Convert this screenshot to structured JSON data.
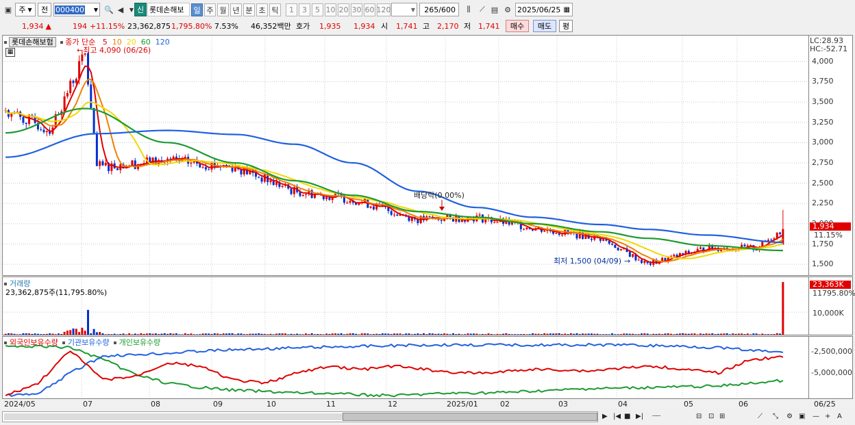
{
  "toolbar": {
    "period_select": "주",
    "prev_label": "전",
    "code_value": "000400",
    "sin_label": "신",
    "stock_name": "롯데손해보",
    "period_tabs": [
      "일",
      "주",
      "월",
      "년",
      "분",
      "초",
      "틱"
    ],
    "active_period": "일",
    "interval_buttons": [
      "1",
      "3",
      "5",
      "10",
      "20",
      "30",
      "60",
      "120"
    ],
    "count_value": "265",
    "count_max": "/600",
    "date_value": "2025/06/25"
  },
  "quote": {
    "price": "1,934",
    "change": "194",
    "change_pct": "+11.15%",
    "volume": "23,362,875",
    "volume_pct": "1,795.80%",
    "turnover": "7.53%",
    "amount": "46,352백만",
    "bid_label": "호가",
    "bid_ask": "1,935",
    "bid_bid": "1,934",
    "open_label": "시",
    "open": "1,741",
    "high_label": "고",
    "high": "2,170",
    "low_label": "저",
    "low": "1,741",
    "buy_label": "매수",
    "sell_label": "매도",
    "flat_label": "평"
  },
  "price_panel": {
    "name_tag": "롯데손해보험",
    "ma_title": "종가 단순",
    "ma_periods": [
      "5",
      "10",
      "20",
      "60",
      "120"
    ],
    "ma_colors": [
      "#e00000",
      "#f08000",
      "#f0d800",
      "#1a9a30",
      "#2060e0"
    ],
    "lc_label": "LC:28.93",
    "hc_label": "HC:-52.71",
    "high_annotation": "최고 4,090 (06/26)",
    "low_annotation": "최저 1,500 (04/09)",
    "dividend_annotation": "배당락(0.00%)",
    "last_price_tag": "1,934",
    "last_change_tag": "11.15%",
    "y_ticks": [
      "4,000",
      "3,750",
      "3,500",
      "3,250",
      "3,000",
      "2,750",
      "2,500",
      "2,250",
      "2,000",
      "1,750",
      "1,500"
    ]
  },
  "volume_panel": {
    "title": "거래량",
    "value_text": "23,362,875주(11,795.80%)",
    "last_tag": "23,363K",
    "last_pct_tag": "11795.80%",
    "y_tick": "10,000K"
  },
  "holdings_panel": {
    "series_labels": [
      "외국인보유수량",
      "기관보유수량",
      "개인보유수량"
    ],
    "series_colors": [
      "#e00000",
      "#2060e0",
      "#1a9a30"
    ],
    "y_ticks": [
      "-2,500,000",
      "-5,000,000"
    ]
  },
  "x_labels": [
    "2024/05",
    "07",
    "08",
    "09",
    "10",
    "11",
    "12",
    "2025/01",
    "02",
    "03",
    "04",
    "05",
    "06",
    "06/25"
  ],
  "chart_data": {
    "type": "candlestick",
    "title": "",
    "ylim": [
      1400,
      4150
    ],
    "x_range": [
      "2024/05",
      "2025/06/25"
    ],
    "close_keypoints": [
      {
        "x": "2024/05",
        "y": 3400
      },
      {
        "x": "2024/06 early",
        "y": 3150
      },
      {
        "x": "2024/06 mid",
        "y": 3700
      },
      {
        "x": "2024/06/26",
        "y": 4090
      },
      {
        "x": "2024/07 early",
        "y": 2700
      },
      {
        "x": "2024/08",
        "y": 2780
      },
      {
        "x": "2024/09",
        "y": 2700
      },
      {
        "x": "2024/10",
        "y": 2400
      },
      {
        "x": "2024/11",
        "y": 2300
      },
      {
        "x": "2024/12",
        "y": 2050
      },
      {
        "x": "2025/01",
        "y": 2080
      },
      {
        "x": "2025/02",
        "y": 1950
      },
      {
        "x": "2025/03",
        "y": 1820
      },
      {
        "x": "2025/04/09",
        "y": 1500
      },
      {
        "x": "2025/05",
        "y": 1700
      },
      {
        "x": "2025/06",
        "y": 1700
      },
      {
        "x": "2025/06/25",
        "y": 1934
      }
    ],
    "last_bar": {
      "open": 1741,
      "high": 2170,
      "low": 1741,
      "close": 1934
    },
    "ma120_keypoints": [
      {
        "x": "2024/05",
        "y": 2820
      },
      {
        "x": "2024/07",
        "y": 3110
      },
      {
        "x": "2024/08",
        "y": 3150
      },
      {
        "x": "2024/09",
        "y": 3100
      },
      {
        "x": "2024/10",
        "y": 2980
      },
      {
        "x": "2024/11",
        "y": 2750
      },
      {
        "x": "2024/12",
        "y": 2400
      },
      {
        "x": "2025/01",
        "y": 2200
      },
      {
        "x": "2025/02",
        "y": 2080
      },
      {
        "x": "2025/03",
        "y": 1990
      },
      {
        "x": "2025/04",
        "y": 1930
      },
      {
        "x": "2025/05",
        "y": 1860
      },
      {
        "x": "2025/06/25",
        "y": 1770
      }
    ],
    "ma60_keypoints": [
      {
        "x": "2024/05",
        "y": 3120
      },
      {
        "x": "2024/06/26",
        "y": 3420
      },
      {
        "x": "2024/08",
        "y": 3000
      },
      {
        "x": "2024/09",
        "y": 2750
      },
      {
        "x": "2024/10",
        "y": 2530
      },
      {
        "x": "2024/11",
        "y": 2350
      },
      {
        "x": "2024/12",
        "y": 2150
      },
      {
        "x": "2025/01",
        "y": 2080
      },
      {
        "x": "2025/02",
        "y": 2000
      },
      {
        "x": "2025/03",
        "y": 1900
      },
      {
        "x": "2025/04",
        "y": 1820
      },
      {
        "x": "2025/05",
        "y": 1730
      },
      {
        "x": "2025/06/25",
        "y": 1670
      }
    ],
    "volume_peak_k": 23363,
    "volume_july_spike_k": 11000,
    "volume_ylim_k": [
      0,
      24000
    ]
  }
}
